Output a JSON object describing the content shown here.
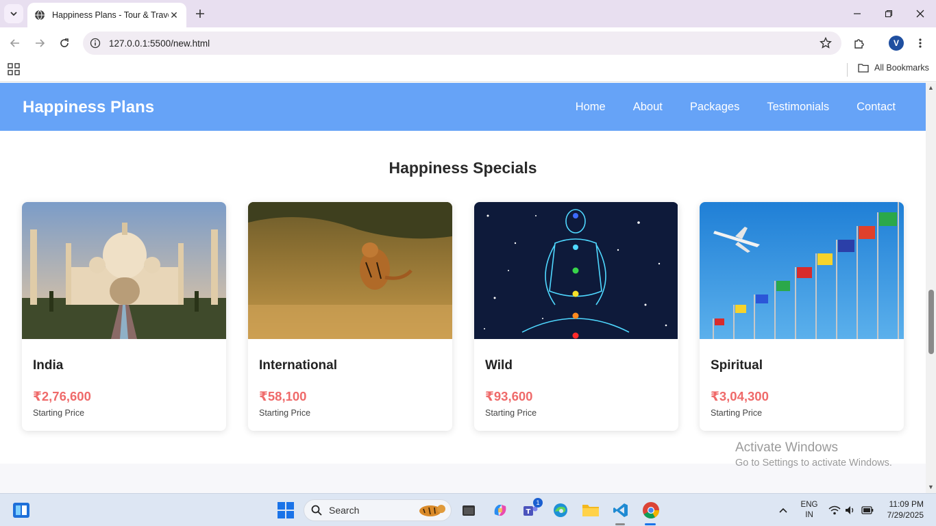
{
  "browser": {
    "tab_title": "Happiness Plans - Tour & Travel",
    "url": "127.0.0.1:5500/new.html",
    "avatar_letter": "V",
    "bookmarks_label": "All Bookmarks"
  },
  "site": {
    "brand": "Happiness Plans",
    "nav": [
      "Home",
      "About",
      "Packages",
      "Testimonials",
      "Contact"
    ],
    "section_title": "Happiness Specials",
    "cards": [
      {
        "name": "India",
        "price": "₹2,76,600",
        "sub": "Starting Price",
        "image": "taj-mahal-image"
      },
      {
        "name": "International",
        "price": "₹58,100",
        "sub": "Starting Price",
        "image": "tiger-savanna-image"
      },
      {
        "name": "Wild",
        "price": "₹93,600",
        "sub": "Starting Price",
        "image": "meditation-chakra-image"
      },
      {
        "name": "Spiritual",
        "price": "₹3,04,300",
        "sub": "Starting Price",
        "image": "airplane-flags-image"
      }
    ],
    "accent_color": "#66a3f7",
    "price_color": "#ef6a6a"
  },
  "watermark": {
    "line1": "Activate Windows",
    "line2": "Go to Settings to activate Windows."
  },
  "taskbar": {
    "search_label": "Search",
    "lang_line1": "ENG",
    "lang_line2": "IN",
    "time": "11:09 PM",
    "date": "7/29/2025",
    "teams_badge": "1"
  }
}
